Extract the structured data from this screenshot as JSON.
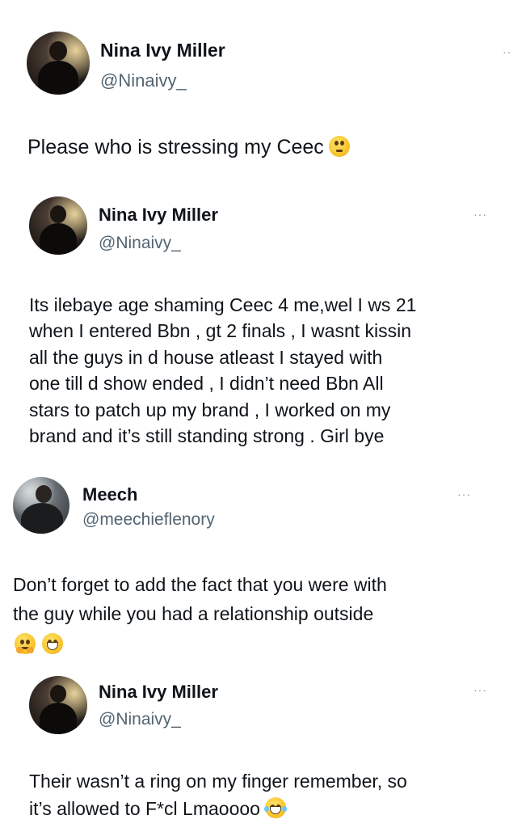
{
  "tweets": [
    {
      "name": "Nina Ivy Miller",
      "handle": "@Ninaivy_",
      "more": "··",
      "text": "Please who is stressing my Ceec",
      "emoji": [
        "rolling-eyes-emoji"
      ]
    },
    {
      "name": "Nina Ivy Miller",
      "handle": "@Ninaivy_",
      "more": "···",
      "lines": [
        "Its ilebaye age shaming Ceec 4 me,wel I ws 21",
        "when I entered Bbn , gt 2 finals , I wasnt kissin",
        "all the guys in d house atleast I stayed with",
        "one till d show ended , I didn’t need Bbn All",
        "stars to patch up my brand , I worked on my",
        "brand and it’s still standing strong . Girl bye"
      ]
    },
    {
      "name": "Meech",
      "handle": "@meechieflenory",
      "more": "···",
      "lines": [
        "Don’t forget to add the fact that you were with",
        "the guy while you had a relationship outside"
      ],
      "emoji": [
        "hugging-face-emoji",
        "grinning-face-emoji"
      ]
    },
    {
      "name": "Nina Ivy Miller",
      "handle": "@Ninaivy_",
      "more": "···",
      "lines": [
        "Their wasn’t a ring on my finger remember, so",
        "it’s allowed to F*cl Lmaoooo"
      ],
      "emoji": [
        "tears-of-joy-emoji"
      ]
    }
  ]
}
